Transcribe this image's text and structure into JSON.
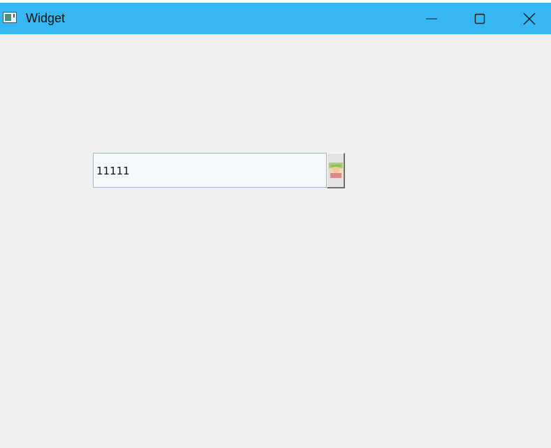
{
  "window": {
    "title": "Widget",
    "title_bar_color": "#36b6f2",
    "background_color": "#f0f0f0",
    "app_icon": "window-app-icon",
    "controls": {
      "minimize_icon": "minimize-icon",
      "maximize_icon": "maximize-icon",
      "close_icon": "close-icon"
    }
  },
  "main": {
    "input": {
      "value": "11111"
    },
    "image_button": {
      "icon": "avatar-image-icon"
    }
  }
}
